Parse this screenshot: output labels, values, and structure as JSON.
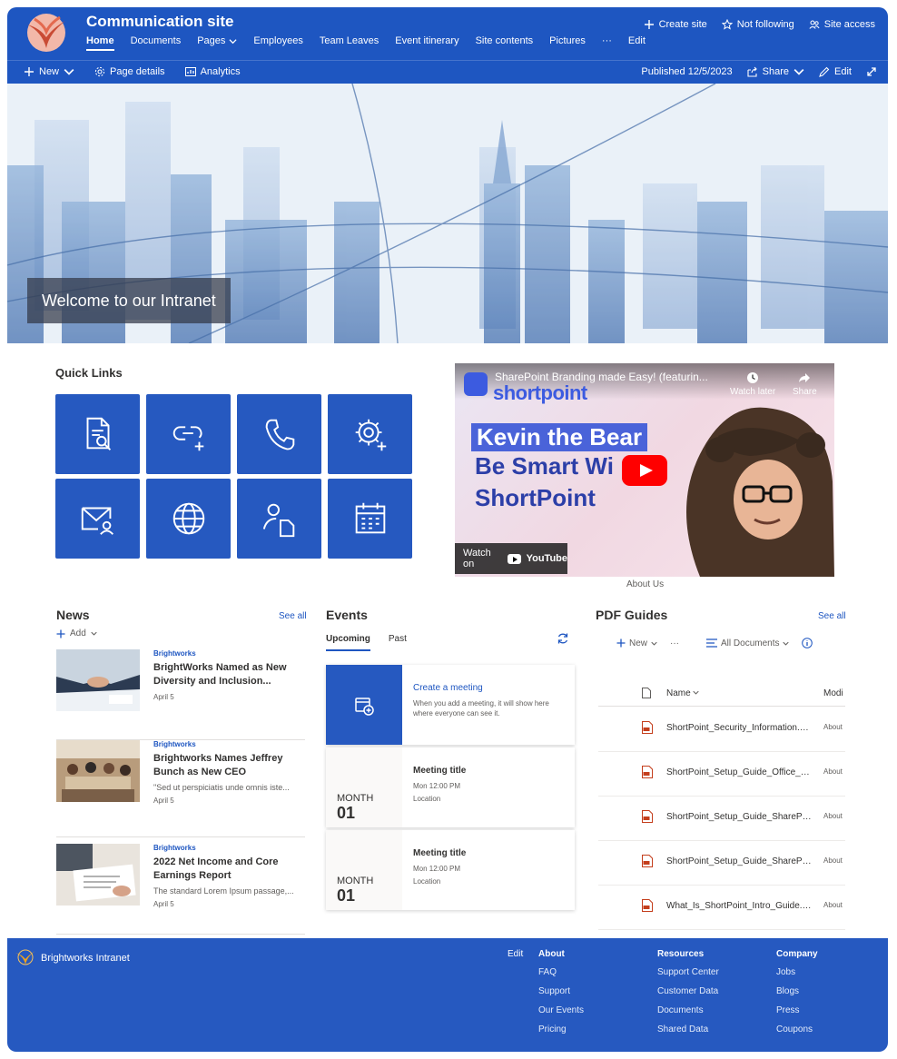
{
  "site": {
    "title": "Communication site"
  },
  "nav": [
    {
      "label": "Home",
      "active": true
    },
    {
      "label": "Documents"
    },
    {
      "label": "Pages",
      "dropdown": true
    },
    {
      "label": "Employees"
    },
    {
      "label": "Team Leaves"
    },
    {
      "label": "Event itinerary"
    },
    {
      "label": "Site contents"
    },
    {
      "label": "Pictures"
    },
    {
      "label": "···"
    },
    {
      "label": "Edit"
    }
  ],
  "top_actions": {
    "create_site": "Create site",
    "not_following": "Not following",
    "site_access": "Site access"
  },
  "command_bar": {
    "new": "New",
    "page_details": "Page details",
    "analytics": "Analytics",
    "published": "Published 12/5/2023",
    "share": "Share",
    "edit": "Edit"
  },
  "hero": {
    "caption": "Welcome to our Intranet"
  },
  "quick_links": {
    "title": "Quick Links",
    "tiles": [
      "document-search-icon",
      "link-add-icon",
      "phone-icon",
      "settings-add-icon",
      "mail-person-icon",
      "globe-icon",
      "person-document-icon",
      "calendar-icon"
    ]
  },
  "video": {
    "title": "SharePoint Branding made Easy! (featurin...",
    "brand": "shortpoint",
    "watch_later": "Watch later",
    "share": "Share",
    "headline_1": "Kevin the Bear",
    "headline_2": "Be Smart Wi",
    "headline_3": "ShortPoint",
    "watch_on": "Watch on",
    "youtube": "YouTube",
    "caption": "About Us"
  },
  "news": {
    "title": "News",
    "see_all": "See all",
    "add": "Add",
    "items": [
      {
        "source": "Brightworks",
        "headline": "BrightWorks Named as New Diversity and Inclusion...",
        "description": "",
        "date": "April 5"
      },
      {
        "source": "Brightworks",
        "headline": "Brightworks Names Jeffrey Bunch as New CEO",
        "description": "\"Sed ut perspiciatis unde omnis iste...",
        "date": "April 5"
      },
      {
        "source": "Brightworks",
        "headline": "2022 Net Income and Core Earnings Report",
        "description": "The standard Lorem Ipsum passage,...",
        "date": "April 5"
      }
    ]
  },
  "events": {
    "title": "Events",
    "tabs": {
      "upcoming": "Upcoming",
      "past": "Past"
    },
    "create": {
      "title": "Create a meeting",
      "text": "When you add a meeting, it will show here where everyone can see it."
    },
    "items": [
      {
        "month": "MONTH",
        "day": "01",
        "title": "Meeting title",
        "time": "Mon 12:00 PM",
        "location": "Location"
      },
      {
        "month": "MONTH",
        "day": "01",
        "title": "Meeting title",
        "time": "Mon 12:00 PM",
        "location": "Location"
      }
    ]
  },
  "pdf_guides": {
    "title": "PDF Guides",
    "see_all": "See all",
    "new": "New",
    "more": "···",
    "view": "All Documents",
    "col_name": "Name",
    "col_modified": "Modi",
    "files": [
      {
        "name": "ShortPoint_Security_Information.p...",
        "modified": "About"
      },
      {
        "name": "ShortPoint_Setup_Guide_Office_3...",
        "modified": "About"
      },
      {
        "name": "ShortPoint_Setup_Guide_SharePoi...",
        "modified": "About"
      },
      {
        "name": "ShortPoint_Setup_Guide_SharePoi...",
        "modified": "About"
      },
      {
        "name": "What_Is_ShortPoint_Intro_Guide.p...",
        "modified": "About"
      }
    ]
  },
  "footer": {
    "brand": "Brightworks Intranet",
    "edit": "Edit",
    "columns": [
      {
        "title": "About",
        "links": [
          "FAQ",
          "Support",
          "Our Events",
          "Pricing"
        ]
      },
      {
        "title": "Resources",
        "links": [
          "Support Center",
          "Customer Data",
          "Documents",
          "Shared Data"
        ]
      },
      {
        "title": "Company",
        "links": [
          "Jobs",
          "Blogs",
          "Press",
          "Coupons"
        ]
      }
    ]
  },
  "colors": {
    "brand_blue": "#1e56c1",
    "tile_blue": "#2659c0",
    "footer_blue": "#2659c0"
  }
}
